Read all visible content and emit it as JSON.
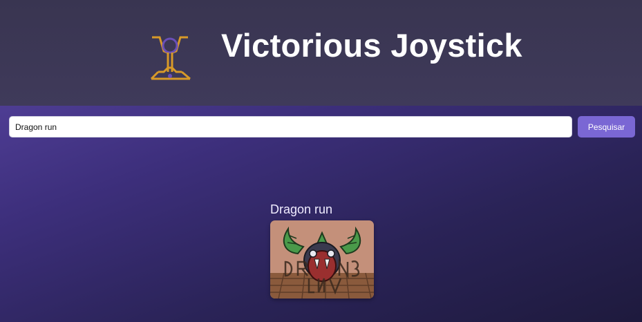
{
  "app": {
    "title": "Victorious Joystick",
    "logo_icon": "trophy-joystick-icon",
    "accent_color": "#7a67d4",
    "header_color": "#3b3654"
  },
  "search": {
    "value": "Dragon run",
    "button_label": "Pesquisar"
  },
  "results": [
    {
      "title": "Dragon run",
      "thumbnail_icon": "dragon-run-cover-art"
    }
  ]
}
